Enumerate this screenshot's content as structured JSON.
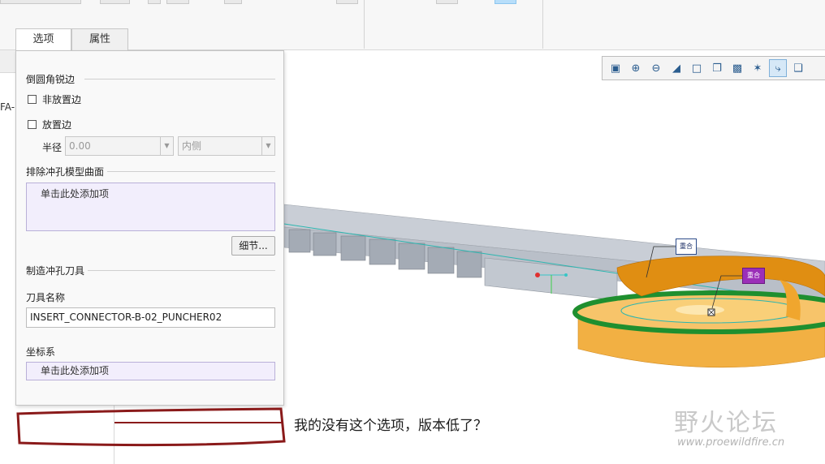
{
  "tabs": [
    {
      "label": "选项",
      "active": true
    },
    {
      "label": "属性",
      "active": false
    }
  ],
  "left_tree": {
    "partial_item": "FA-"
  },
  "panel": {
    "sharp_edges_title": "倒圆角锐边",
    "checkbox_non_placement": "非放置边",
    "checkbox_placement": "放置边",
    "radius_label": "半径",
    "radius_value": "0.00",
    "side_value": "内侧",
    "exclude_title": "排除冲孔模型曲面",
    "exclude_collector": "单击此处添加项",
    "details_button": "细节...",
    "tool_section_title": "制造冲孔刀具",
    "tool_name_label": "刀具名称",
    "tool_name_value": "INSERT_CONNECTOR-B-02_PUNCHER02",
    "csys_label": "坐标系",
    "csys_collector": "单击此处添加项"
  },
  "view_toolbar": {
    "icons": [
      "zoom-fit-icon",
      "zoom-in-icon",
      "zoom-out-icon",
      "repaint-icon",
      "display-style-icon",
      "saved-views-icon",
      "view-manager-icon",
      "datum-display-icon",
      "spin-center-icon",
      "annotation-display-icon"
    ],
    "active_index": 8
  },
  "model_tags": [
    "重合",
    "重合"
  ],
  "annotation": {
    "text": "我的没有这个选项，版本低了？"
  },
  "watermark": {
    "main": "野火论坛",
    "url": "www.proewildfire.cn"
  },
  "colors": {
    "accent_orange": "#f0a030",
    "highlight_green": "#1f8f2f",
    "tag_purple": "#9b2fb8",
    "collector_lilac": "#f2eefc",
    "annotation_red": "#8a1a1a"
  }
}
